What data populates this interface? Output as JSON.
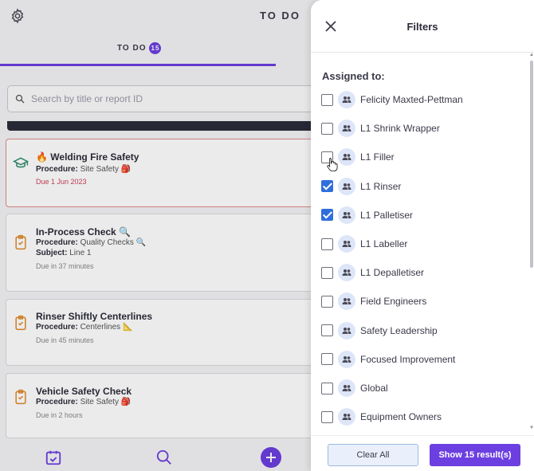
{
  "app": {
    "title": "TO DO",
    "tab_label": "TO DO",
    "tab_count": "15",
    "search_placeholder": "Search by title or report ID"
  },
  "cards": [
    {
      "icon": "graduation-cap-icon",
      "emoji": "🔥",
      "title": "Welding Fire Safety",
      "procedure_label": "Procedure:",
      "procedure": "Site Safety",
      "procedure_icon": "🎒",
      "due": "Due 1 Jun 2023",
      "due_overdue": true
    },
    {
      "icon": "clipboard-check-icon",
      "emoji": "",
      "title": "In-Process Check",
      "title_icon": "🔍",
      "procedure_label": "Procedure:",
      "procedure": "Quality Checks",
      "procedure_icon": "🔍",
      "subject_label": "Subject:",
      "subject": "Line 1",
      "due": "Due in 37 minutes",
      "due_overdue": false
    },
    {
      "icon": "clipboard-check-icon",
      "emoji": "",
      "title": "Rinser Shiftly Centerlines",
      "procedure_label": "Procedure:",
      "procedure": "Centerlines",
      "procedure_icon": "📐",
      "due": "Due in 45 minutes",
      "due_overdue": false
    },
    {
      "icon": "clipboard-check-icon",
      "emoji": "",
      "title": "Vehicle Safety Check",
      "procedure_label": "Procedure:",
      "procedure": "Site Safety",
      "procedure_icon": "🎒",
      "due": "Due in 2 hours",
      "due_overdue": false
    }
  ],
  "filters": {
    "title": "Filters",
    "section_title": "Assigned to:",
    "options": [
      {
        "label": "Felicity Maxted-Pettman",
        "checked": false
      },
      {
        "label": "L1 Shrink Wrapper",
        "checked": false
      },
      {
        "label": "L1 Filler",
        "checked": false
      },
      {
        "label": "L1 Rinser",
        "checked": true
      },
      {
        "label": "L1 Palletiser",
        "checked": true
      },
      {
        "label": "L1 Labeller",
        "checked": false
      },
      {
        "label": "L1 Depalletiser",
        "checked": false
      },
      {
        "label": "Field Engineers",
        "checked": false
      },
      {
        "label": "Safety Leadership",
        "checked": false
      },
      {
        "label": "Focused Improvement",
        "checked": false
      },
      {
        "label": "Global",
        "checked": false
      },
      {
        "label": "Equipment Owners",
        "checked": false
      }
    ],
    "clear_label": "Clear All",
    "show_label": "Show 15 result(s)"
  },
  "colors": {
    "accent": "#6c3fe0",
    "checkbox_checked": "#2f6fdc",
    "icon_orange": "#e0892a",
    "icon_green": "#2f8a6a",
    "overdue_red": "#d0405a"
  }
}
